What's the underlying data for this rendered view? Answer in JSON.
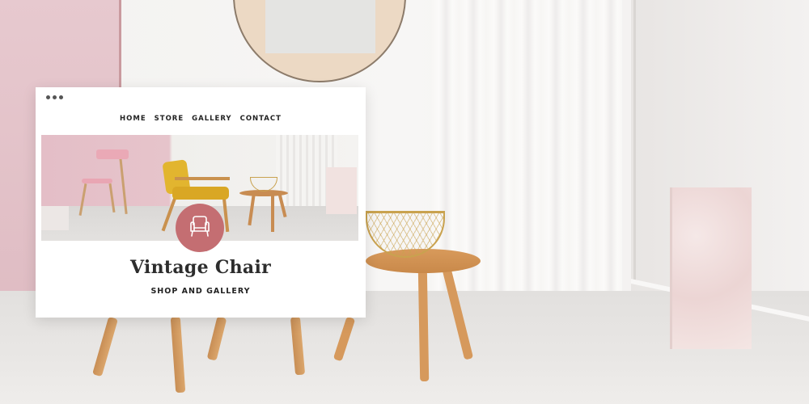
{
  "nav": {
    "items": [
      {
        "label": "HOME"
      },
      {
        "label": "STORE"
      },
      {
        "label": "GALLERY"
      },
      {
        "label": "CONTACT"
      }
    ]
  },
  "site": {
    "title": "Vintage Chair",
    "subtitle": "SHOP AND GALLERY"
  },
  "icons": {
    "logo": "armchair-icon",
    "window_controls": "window-dots-icon"
  },
  "colors": {
    "logo_badge": "#c46e72",
    "text": "#2d2d2d",
    "page": "#ffffff"
  }
}
